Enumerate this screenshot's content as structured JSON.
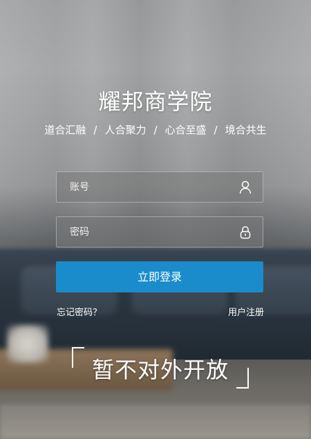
{
  "header": {
    "title": "耀邦商学院",
    "slogan": [
      "道合汇融",
      "人合聚力",
      "心合至盛",
      "境合共生"
    ],
    "separator": "/"
  },
  "login_form": {
    "account": {
      "placeholder": "账号",
      "value": "",
      "icon": "user-icon"
    },
    "password": {
      "placeholder": "密码",
      "value": "",
      "icon": "lock-icon"
    },
    "submit_label": "立即登录",
    "forgot_label": "忘记密码？",
    "register_label": "用户注册"
  },
  "notice": {
    "text": "暂不对外开放"
  },
  "colors": {
    "accent": "#1a8ccc",
    "text": "#ffffff"
  }
}
